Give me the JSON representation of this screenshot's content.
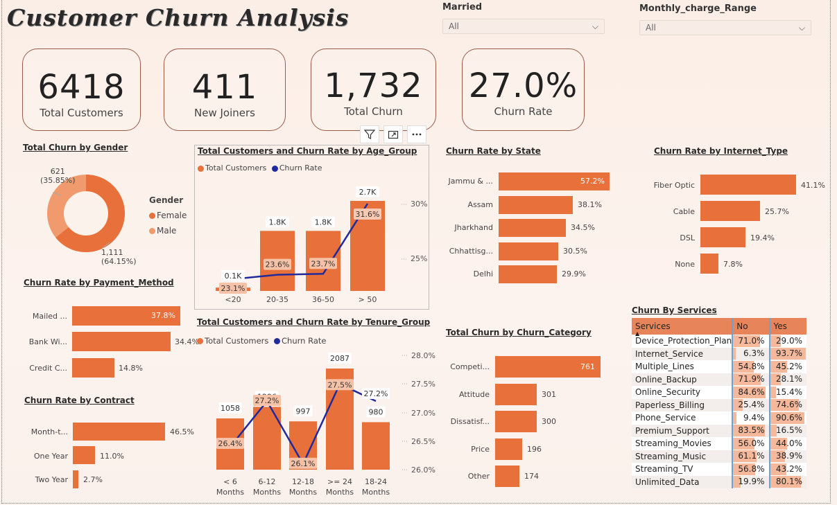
{
  "header": {
    "title": "Customer Churn Analysis"
  },
  "slicers": [
    {
      "label": "Married",
      "value": "All"
    },
    {
      "label": "Monthly_charge_Range",
      "value": "All"
    }
  ],
  "kpis": [
    {
      "value": "6418",
      "label": "Total Customers"
    },
    {
      "value": "411",
      "label": "New Joiners"
    },
    {
      "value": "1,732",
      "label": "Total Churn"
    },
    {
      "value": "27.0%",
      "label": "Churn Rate"
    }
  ],
  "colors": {
    "accent": "#e8703a",
    "accent_light": "#f09a6e",
    "line": "#1f2a9c",
    "highlight_blue": "#6aa4d6"
  },
  "toolbar": {
    "icons": [
      "filter-icon",
      "focus-mode-icon",
      "more-options-icon"
    ]
  },
  "gender": {
    "title": "Total Churn by Gender",
    "legend_title": "Gender",
    "female_label": "Female",
    "male_label": "Male",
    "female_value": "1,111",
    "female_pct": "(64.15%)",
    "male_value": "621",
    "male_pct": "(35.85%)"
  },
  "payment": {
    "title": "Churn Rate by Payment_Method",
    "items": [
      {
        "label": "Mailed ...",
        "value": "37.8%",
        "num": 37.8
      },
      {
        "label": "Bank Wi...",
        "value": "34.4%",
        "num": 34.4
      },
      {
        "label": "Credit C...",
        "value": "14.8%",
        "num": 14.8
      }
    ]
  },
  "contract": {
    "title": "Churn Rate by Contract",
    "items": [
      {
        "label": "Month-t...",
        "value": "46.5%",
        "num": 46.5
      },
      {
        "label": "One Year",
        "value": "11.0%",
        "num": 11.0
      },
      {
        "label": "Two Year",
        "value": "2.7%",
        "num": 2.7
      }
    ]
  },
  "age": {
    "title": "Total Customers and Churn Rate by Age_Group",
    "legend_customers": "Total Customers",
    "legend_rate": "Churn Rate",
    "axis_right": [
      "30%",
      "25%"
    ]
  },
  "tenure": {
    "title": "Total Customers and Churn Rate by Tenure_Group",
    "legend_customers": "Total Customers",
    "legend_rate": "Churn Rate",
    "axis_right": [
      "28.0%",
      "27.5%",
      "27.0%",
      "26.5%",
      "26.0%"
    ]
  },
  "state": {
    "title": "Churn Rate by State",
    "items": [
      {
        "label": "Jammu & ...",
        "value": "57.2%",
        "num": 57.2
      },
      {
        "label": "Assam",
        "value": "38.1%",
        "num": 38.1
      },
      {
        "label": "Jharkhand",
        "value": "34.5%",
        "num": 34.5
      },
      {
        "label": "Chhattisg...",
        "value": "30.5%",
        "num": 30.5
      },
      {
        "label": "Delhi",
        "value": "29.9%",
        "num": 29.9
      }
    ]
  },
  "category": {
    "title": "Total Churn by Churn_Category",
    "items": [
      {
        "label": "Competi...",
        "value": "761",
        "num": 761
      },
      {
        "label": "Attitude",
        "value": "301",
        "num": 301
      },
      {
        "label": "Dissatisf...",
        "value": "300",
        "num": 300
      },
      {
        "label": "Price",
        "value": "196",
        "num": 196
      },
      {
        "label": "Other",
        "value": "174",
        "num": 174
      }
    ]
  },
  "internet": {
    "title": "Churn Rate by Internet_Type",
    "items": [
      {
        "label": "Fiber Optic",
        "value": "41.1%",
        "num": 41.1
      },
      {
        "label": "Cable",
        "value": "25.7%",
        "num": 25.7
      },
      {
        "label": "DSL",
        "value": "19.4%",
        "num": 19.4
      },
      {
        "label": "None",
        "value": "7.8%",
        "num": 7.8
      }
    ]
  },
  "services": {
    "title": "Churn By Services",
    "columns": [
      "Services",
      "No",
      "Yes"
    ],
    "rows": [
      {
        "name": "Device_Protection_Plan",
        "no": "71.0%",
        "yes": "29.0%",
        "no_num": 71.0,
        "yes_num": 29.0
      },
      {
        "name": "Internet_Service",
        "no": "6.3%",
        "yes": "93.7%",
        "no_num": 6.3,
        "yes_num": 93.7
      },
      {
        "name": "Multiple_Lines",
        "no": "54.8%",
        "yes": "45.2%",
        "no_num": 54.8,
        "yes_num": 45.2
      },
      {
        "name": "Online_Backup",
        "no": "71.9%",
        "yes": "28.1%",
        "no_num": 71.9,
        "yes_num": 28.1
      },
      {
        "name": "Online_Security",
        "no": "84.6%",
        "yes": "15.4%",
        "no_num": 84.6,
        "yes_num": 15.4
      },
      {
        "name": "Paperless_Billing",
        "no": "25.4%",
        "yes": "74.6%",
        "no_num": 25.4,
        "yes_num": 74.6
      },
      {
        "name": "Phone_Service",
        "no": "9.4%",
        "yes": "90.6%",
        "no_num": 9.4,
        "yes_num": 90.6
      },
      {
        "name": "Premium_Support",
        "no": "83.5%",
        "yes": "16.5%",
        "no_num": 83.5,
        "yes_num": 16.5
      },
      {
        "name": "Streaming_Movies",
        "no": "56.0%",
        "yes": "44.0%",
        "no_num": 56.0,
        "yes_num": 44.0
      },
      {
        "name": "Streaming_Music",
        "no": "61.1%",
        "yes": "38.9%",
        "no_num": 61.1,
        "yes_num": 38.9
      },
      {
        "name": "Streaming_TV",
        "no": "56.8%",
        "yes": "43.2%",
        "no_num": 56.8,
        "yes_num": 43.2
      },
      {
        "name": "Unlimited_Data",
        "no": "19.9%",
        "yes": "80.1%",
        "no_num": 19.9,
        "yes_num": 80.1
      }
    ]
  },
  "chart_data": [
    {
      "type": "pie",
      "title": "Total Churn by Gender",
      "categories": [
        "Female",
        "Male"
      ],
      "values": [
        1111,
        621
      ],
      "labels": [
        "1,111 (64.15%)",
        "621 (35.85%)"
      ]
    },
    {
      "type": "bar",
      "title": "Total Customers and Churn Rate by Age_Group",
      "categories": [
        "<20",
        "20-35",
        "36-50",
        "> 50"
      ],
      "series": [
        {
          "name": "Total Customers",
          "values": [
            100,
            1800,
            1800,
            2700
          ],
          "labels": [
            "0.1K",
            "1.8K",
            "1.8K",
            "2.7K"
          ]
        },
        {
          "name": "Churn Rate",
          "values": [
            23.1,
            23.6,
            23.7,
            31.6
          ],
          "labels": [
            "23.1%",
            "23.6%",
            "23.7%",
            "31.6%"
          ]
        }
      ],
      "y2lim": [
        20,
        32
      ]
    },
    {
      "type": "bar",
      "title": "Total Customers and Churn Rate by Tenure_Group",
      "categories": [
        "< 6 Months",
        "6-12 Months",
        "12-18 Months",
        ">= 24 Months",
        "18-24 Months"
      ],
      "series": [
        {
          "name": "Total Customers",
          "values": [
            1058,
            1296,
            997,
            2087,
            980
          ]
        },
        {
          "name": "Churn Rate",
          "values": [
            26.4,
            27.2,
            26.1,
            27.5,
            27.2
          ],
          "labels": [
            "26.4%",
            "27.2%",
            "26.1%",
            "27.5%",
            "27.2%"
          ]
        }
      ],
      "y2lim": [
        26.0,
        28.0
      ]
    },
    {
      "type": "bar",
      "title": "Churn Rate by Payment_Method",
      "categories": [
        "Mailed ...",
        "Bank Wi...",
        "Credit C..."
      ],
      "values": [
        37.8,
        34.4,
        14.8
      ]
    },
    {
      "type": "bar",
      "title": "Churn Rate by Contract",
      "categories": [
        "Month-t...",
        "One Year",
        "Two Year"
      ],
      "values": [
        46.5,
        11.0,
        2.7
      ]
    },
    {
      "type": "bar",
      "title": "Churn Rate by State",
      "categories": [
        "Jammu & ...",
        "Assam",
        "Jharkhand",
        "Chhattisg...",
        "Delhi"
      ],
      "values": [
        57.2,
        38.1,
        34.5,
        30.5,
        29.9
      ]
    },
    {
      "type": "bar",
      "title": "Total Churn by Churn_Category",
      "categories": [
        "Competi...",
        "Attitude",
        "Dissatisf...",
        "Price",
        "Other"
      ],
      "values": [
        761,
        301,
        300,
        196,
        174
      ]
    },
    {
      "type": "bar",
      "title": "Churn Rate by Internet_Type",
      "categories": [
        "Fiber Optic",
        "Cable",
        "DSL",
        "None"
      ],
      "values": [
        41.1,
        25.7,
        19.4,
        7.8
      ]
    }
  ]
}
